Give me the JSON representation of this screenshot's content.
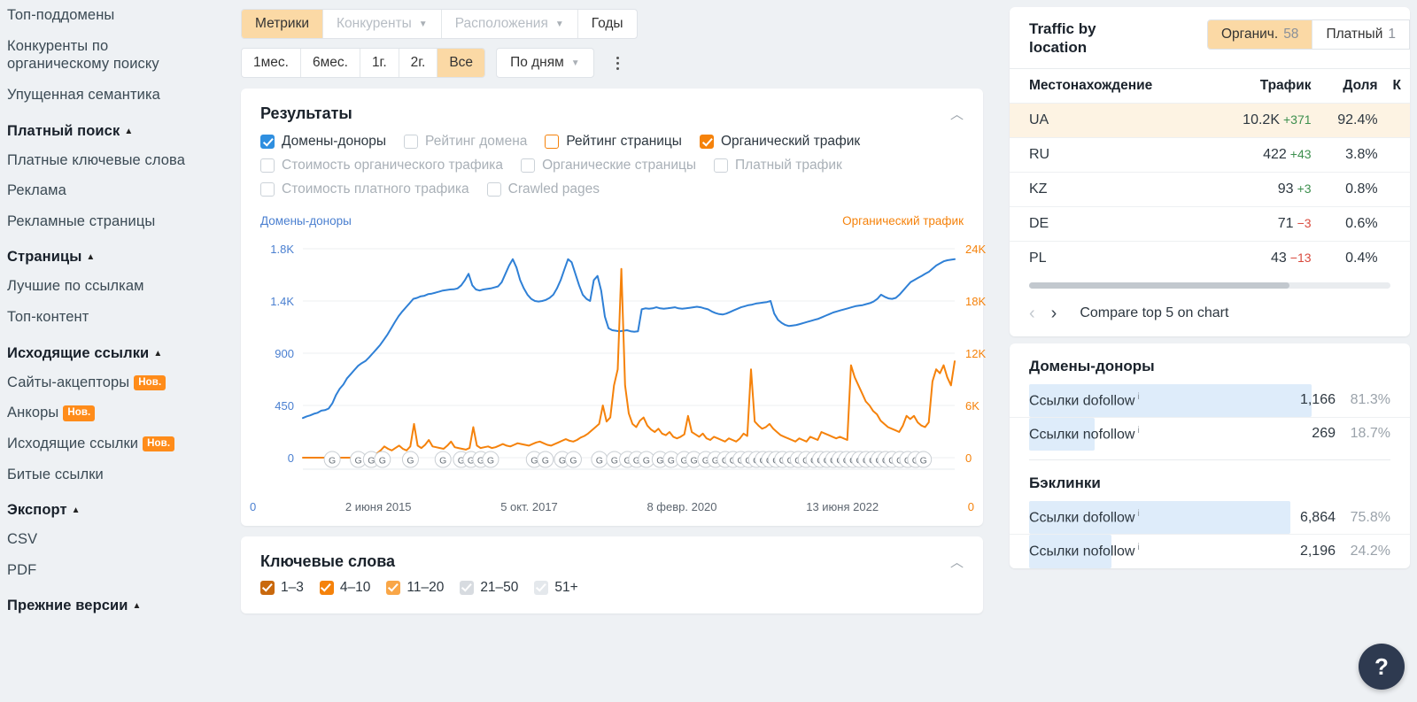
{
  "sidebar": {
    "items": [
      {
        "label": "Топ-поддомены",
        "type": "link"
      },
      {
        "label": "Конкуренты по органическому поиску",
        "type": "link"
      },
      {
        "label": "Упущенная семантика",
        "type": "link"
      },
      {
        "label": "Платный поиск",
        "type": "group"
      },
      {
        "label": "Платные ключевые слова",
        "type": "link"
      },
      {
        "label": "Реклама",
        "type": "link"
      },
      {
        "label": "Рекламные страницы",
        "type": "link"
      },
      {
        "label": "Страницы",
        "type": "group"
      },
      {
        "label": "Лучшие по ссылкам",
        "type": "link"
      },
      {
        "label": "Топ-контент",
        "type": "link"
      },
      {
        "label": "Исходящие ссылки",
        "type": "group"
      },
      {
        "label": "Сайты-акцепторы",
        "type": "link",
        "badge": "Нов."
      },
      {
        "label": "Анкоры",
        "type": "link",
        "badge": "Нов."
      },
      {
        "label": "Исходящие ссылки",
        "type": "link",
        "badge": "Нов."
      },
      {
        "label": "Битые ссылки",
        "type": "link"
      },
      {
        "label": "Экспорт",
        "type": "group"
      },
      {
        "label": "CSV",
        "type": "link"
      },
      {
        "label": "PDF",
        "type": "link"
      },
      {
        "label": "Прежние версии",
        "type": "group"
      }
    ]
  },
  "toolbar": {
    "tabs": [
      {
        "label": "Метрики",
        "state": "active"
      },
      {
        "label": "Конкуренты",
        "state": "disabled",
        "caret": true
      },
      {
        "label": "Расположения",
        "state": "disabled",
        "caret": true
      },
      {
        "label": "Годы",
        "state": "normal"
      }
    ],
    "ranges": [
      {
        "label": "1мес.",
        "state": "normal"
      },
      {
        "label": "6мес.",
        "state": "normal"
      },
      {
        "label": "1г.",
        "state": "normal"
      },
      {
        "label": "2г.",
        "state": "normal"
      },
      {
        "label": "Все",
        "state": "active"
      }
    ],
    "granularity": "По дням",
    "more_icon": "kebab-menu-icon"
  },
  "results": {
    "title": "Результаты",
    "collapse_icon": "chevron-up-icon",
    "metrics_row1": [
      {
        "label": "Домены-доноры",
        "state": "checked-blue"
      },
      {
        "label": "Рейтинг домена",
        "state": "unchecked"
      },
      {
        "label": "Рейтинг страницы",
        "state": "ring-orange"
      },
      {
        "label": "Органический трафик",
        "state": "checked-orange"
      }
    ],
    "metrics_row2": [
      {
        "label": "Стоимость органического трафика",
        "state": "unchecked"
      },
      {
        "label": "Органические страницы",
        "state": "unchecked"
      },
      {
        "label": "Платный трафик",
        "state": "unchecked"
      }
    ],
    "metrics_row3": [
      {
        "label": "Стоимость платного трафика",
        "state": "unchecked"
      },
      {
        "label": "Crawled pages",
        "state": "unchecked"
      }
    ]
  },
  "chart_data": {
    "type": "line",
    "title": "Результаты",
    "legend_left": "Домены-доноры",
    "legend_right": "Органический трафик",
    "legend_position": "top-outside",
    "grid": true,
    "left_axis": {
      "name": "Домены-доноры",
      "color": "#4a7fd0",
      "ticks": [
        "1.8K",
        "1.4K",
        "900",
        "450",
        "0"
      ],
      "tick_values": [
        1800,
        1400,
        900,
        450,
        0
      ],
      "ylim": [
        0,
        2000
      ]
    },
    "right_axis": {
      "name": "Органический трафик",
      "color": "#f5820b",
      "ticks": [
        "24K",
        "18K",
        "12K",
        "6K",
        "0"
      ],
      "tick_values": [
        24000,
        18000,
        12000,
        6000,
        0
      ],
      "ylim": [
        0,
        26000
      ]
    },
    "xlabels": [
      "2 июня 2015",
      "5 окт. 2017",
      "8 февр. 2020",
      "13 июня 2022"
    ],
    "xlabel_positions": [
      0.06,
      0.34,
      0.62,
      0.9
    ],
    "series": [
      {
        "name": "Домены-доноры",
        "color": "#2f80d6",
        "axis": "left",
        "values": [
          380,
          395,
          405,
          420,
          430,
          450,
          455,
          470,
          520,
          600,
          660,
          700,
          760,
          800,
          840,
          880,
          905,
          925,
          960,
          1000,
          1040,
          1080,
          1130,
          1180,
          1240,
          1300,
          1355,
          1400,
          1440,
          1480,
          1520,
          1530,
          1545,
          1550,
          1565,
          1570,
          1580,
          1590,
          1600,
          1605,
          1610,
          1612,
          1620,
          1650,
          1700,
          1760,
          1650,
          1610,
          1600,
          1610,
          1615,
          1620,
          1630,
          1640,
          1680,
          1760,
          1840,
          1900,
          1820,
          1700,
          1620,
          1560,
          1520,
          1500,
          1495,
          1500,
          1510,
          1530,
          1560,
          1620,
          1700,
          1800,
          1900,
          1870,
          1760,
          1650,
          1560,
          1520,
          1500,
          1700,
          1740,
          1600,
          1350,
          1240,
          1220,
          1215,
          1210,
          1215,
          1220,
          1210,
          1205,
          1210,
          1420,
          1430,
          1425,
          1430,
          1440,
          1430,
          1425,
          1430,
          1435,
          1440,
          1430,
          1425,
          1430,
          1435,
          1440,
          1445,
          1440,
          1430,
          1420,
          1400,
          1385,
          1375,
          1370,
          1380,
          1395,
          1410,
          1425,
          1440,
          1450,
          1460,
          1465,
          1475,
          1480,
          1485,
          1490,
          1500,
          1380,
          1320,
          1290,
          1270,
          1260,
          1265,
          1270,
          1280,
          1290,
          1300,
          1310,
          1320,
          1330,
          1345,
          1360,
          1375,
          1390,
          1400,
          1410,
          1420,
          1430,
          1440,
          1450,
          1455,
          1460,
          1470,
          1480,
          1495,
          1520,
          1560,
          1540,
          1525,
          1520,
          1530,
          1560,
          1600,
          1640,
          1680,
          1700,
          1720,
          1740,
          1760,
          1780,
          1810,
          1840,
          1860,
          1880,
          1890,
          1895,
          1900
        ]
      },
      {
        "name": "Органический трафик",
        "color": "#f5820b",
        "axis": "right",
        "values": [
          0,
          0,
          0,
          0,
          0,
          0,
          0,
          0,
          0,
          0,
          0,
          0,
          0,
          0,
          0,
          0,
          0,
          0,
          0,
          300,
          520,
          900,
          1400,
          1100,
          900,
          1200,
          1500,
          1100,
          900,
          1400,
          4200,
          1500,
          1200,
          1600,
          2200,
          1400,
          1300,
          1200,
          1100,
          1500,
          2000,
          1300,
          1200,
          1100,
          1000,
          1200,
          3800,
          1500,
          1200,
          1300,
          1400,
          1200,
          1300,
          1500,
          1700,
          1500,
          1400,
          1600,
          1800,
          1700,
          1600,
          1500,
          1700,
          1900,
          2000,
          1800,
          1600,
          1500,
          1700,
          1900,
          2100,
          2300,
          2100,
          2000,
          2200,
          2500,
          2700,
          3000,
          3400,
          3800,
          4200,
          6500,
          4500,
          5000,
          9000,
          11000,
          23500,
          9000,
          5500,
          4200,
          3800,
          4600,
          5000,
          4000,
          3500,
          3200,
          3600,
          3000,
          2800,
          3200,
          2600,
          2400,
          2600,
          2900,
          5200,
          3200,
          2900,
          2600,
          3000,
          2400,
          2200,
          2600,
          2400,
          2200,
          2000,
          2400,
          2200,
          2000,
          2400,
          3000,
          2700,
          11000,
          4500,
          4000,
          3600,
          3800,
          4200,
          3600,
          3200,
          2800,
          2600,
          2400,
          2200,
          2000,
          2400,
          2200,
          2000,
          2600,
          2400,
          2200,
          3200,
          3000,
          2800,
          2600,
          2400,
          2600,
          2400,
          2200,
          11500,
          10000,
          9000,
          8000,
          7000,
          6500,
          5800,
          5400,
          4600,
          4200,
          3800,
          3600,
          3400,
          3200,
          4000,
          5200,
          4800,
          5200,
          4400,
          4000,
          3800,
          4400,
          9500,
          11000,
          10500,
          11500,
          10000,
          9000,
          12000
        ]
      }
    ],
    "event_markers": {
      "icon": "google-update-marker",
      "label": "G",
      "count": 54
    }
  },
  "keywords": {
    "title": "Ключевые слова",
    "collapse_icon": "chevron-up-icon",
    "buckets": [
      {
        "label": "1–3",
        "color": "#c9690e",
        "checked": true
      },
      {
        "label": "4–10",
        "color": "#f5820b",
        "checked": true
      },
      {
        "label": "11–20",
        "color": "#f9a647",
        "checked": true
      },
      {
        "label": "21–50",
        "color": "#d7dbe0",
        "checked": true
      },
      {
        "label": "51+",
        "color": "#e4e8ec",
        "checked": true
      }
    ]
  },
  "traffic_by_location": {
    "title": "Traffic by location",
    "tabs": [
      {
        "label": "Органич.",
        "count": "58",
        "active": true
      },
      {
        "label": "Платный",
        "count": "1",
        "active": false
      }
    ],
    "columns": [
      "Местонахождение",
      "Трафик",
      "Доля",
      "К"
    ],
    "rows": [
      {
        "location": "UA",
        "traffic": "10.2K",
        "change": "+371",
        "dir": "up",
        "share": "92.4%",
        "highlight": true
      },
      {
        "location": "RU",
        "traffic": "422",
        "change": "+43",
        "dir": "up",
        "share": "3.8%",
        "highlight": false
      },
      {
        "location": "KZ",
        "traffic": "93",
        "change": "+3",
        "dir": "up",
        "share": "0.8%",
        "highlight": false
      },
      {
        "location": "DE",
        "traffic": "71",
        "change": "−3",
        "dir": "down",
        "share": "0.6%",
        "highlight": false
      },
      {
        "location": "PL",
        "traffic": "43",
        "change": "−13",
        "dir": "down",
        "share": "0.4%",
        "highlight": false
      }
    ],
    "prev_icon": "chevron-left-icon",
    "next_icon": "chevron-right-icon",
    "compare_label": "Compare top 5 on chart"
  },
  "links_panel": {
    "donors_title": "Домены-доноры",
    "donors_rows": [
      {
        "label": "Ссылки dofollow",
        "info": "i",
        "value": "1,166",
        "pct": "81.3%",
        "fill": 82
      },
      {
        "label": "Ссылки nofollow",
        "info": "i",
        "value": "269",
        "pct": "18.7%",
        "fill": 19
      }
    ],
    "backlinks_title": "Бэклинки",
    "backlinks_rows": [
      {
        "label": "Ссылки dofollow",
        "info": "i",
        "value": "6,864",
        "pct": "75.8%",
        "fill": 76
      },
      {
        "label": "Ссылки nofollow",
        "info": "i",
        "value": "2,196",
        "pct": "24.2%",
        "fill": 24
      }
    ]
  },
  "help": {
    "icon": "question-mark-icon",
    "label": "?"
  }
}
